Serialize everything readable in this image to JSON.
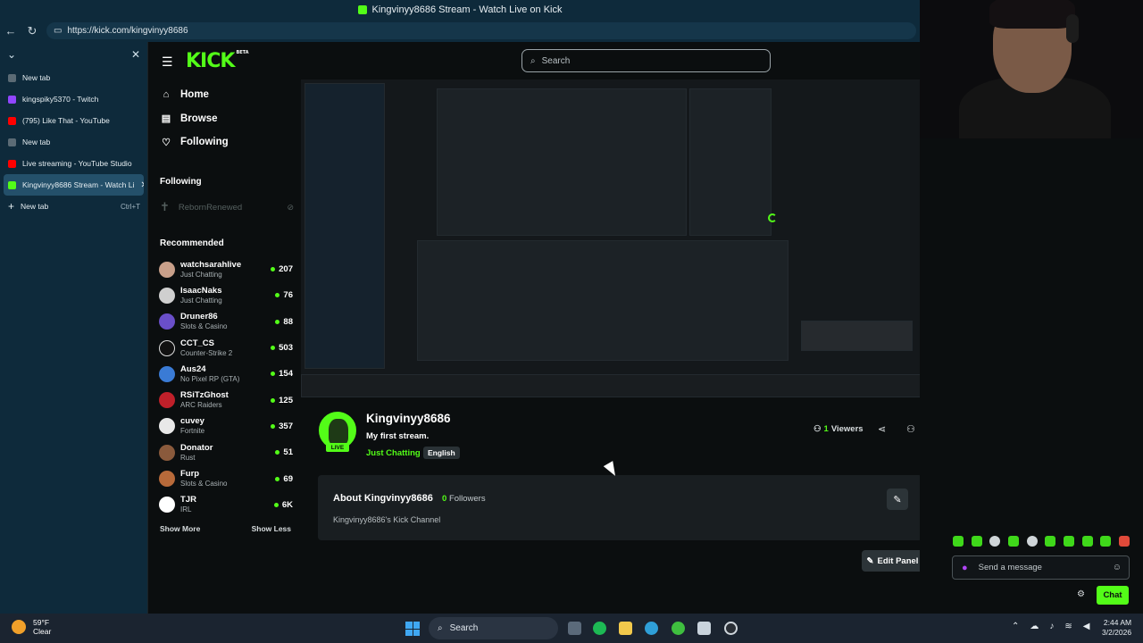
{
  "browser": {
    "window_title": "Kingvinyy8686 Stream - Watch Live on Kick",
    "url": "https://kick.com/kingvinyy8686",
    "tabs": [
      {
        "label": "New tab",
        "favicon_color": "#5b6b75"
      },
      {
        "label": "kingspiky5370 - Twitch",
        "favicon_color": "#9146ff"
      },
      {
        "label": "(795) Like That - YouTube",
        "favicon_color": "#ff0000"
      },
      {
        "label": "New tab",
        "favicon_color": "#5b6b75"
      },
      {
        "label": "Live streaming - YouTube Studio",
        "favicon_color": "#ff0000"
      },
      {
        "label": "Kingvinyy8686 Stream - Watch Li",
        "favicon_color": "#53fc18"
      }
    ],
    "new_tab_label": "New tab",
    "new_tab_shortcut": "Ctrl+T"
  },
  "kick": {
    "logo": "KICK",
    "logo_badge": "BETA",
    "search_placeholder": "Search",
    "nav": [
      {
        "label": "Home",
        "icon": "home-icon"
      },
      {
        "label": "Browse",
        "icon": "browse-icon"
      },
      {
        "label": "Following",
        "icon": "heart-icon"
      }
    ],
    "following_title": "Following",
    "following": [
      {
        "name": "RebornRenewed"
      }
    ],
    "recommended_title": "Recommended",
    "recommended": [
      {
        "name": "watchsarahlive",
        "category": "Just Chatting",
        "viewers": "207",
        "color": "#c9a08a"
      },
      {
        "name": "IsaacNaks",
        "category": "Just Chatting",
        "viewers": "76",
        "color": "#cfcfcf"
      },
      {
        "name": "Druner86",
        "category": "Slots & Casino",
        "viewers": "88",
        "color": "#6a4fc9"
      },
      {
        "name": "CCT_CS",
        "category": "Counter-Strike 2",
        "viewers": "503",
        "color": "#111111"
      },
      {
        "name": "Aus24",
        "category": "No Pixel RP (GTA)",
        "viewers": "154",
        "color": "#3a7bd5"
      },
      {
        "name": "RSiTzGhost",
        "category": "ARC Raiders",
        "viewers": "125",
        "color": "#c0202a"
      },
      {
        "name": "cuvey",
        "category": "Fortnite",
        "viewers": "357",
        "color": "#e8e8e8"
      },
      {
        "name": "Donator",
        "category": "Rust",
        "viewers": "51",
        "color": "#8a5a3c"
      },
      {
        "name": "Furp",
        "category": "Slots & Casino",
        "viewers": "69",
        "color": "#b86a3a"
      },
      {
        "name": "TJR",
        "category": "IRL",
        "viewers": "6K",
        "color": "#ffffff"
      }
    ],
    "show_more": "Show More",
    "show_less": "Show Less",
    "stream": {
      "streamer": "Kingvinyy8686",
      "title": "My first stream.",
      "category": "Just Chatting",
      "language": "English",
      "live_badge": "LIVE",
      "viewers_count": "1",
      "viewers_label": "Viewers"
    },
    "about": {
      "title": "About Kingvinyy8686",
      "followers_count": "0",
      "followers_label": "Followers",
      "description": "Kingvinyy8686's Kick Channel"
    },
    "edit_panel": "Edit Panel",
    "chat": {
      "placeholder": "Send a message",
      "button": "Chat"
    },
    "accent": "#53fc18"
  },
  "taskbar": {
    "temperature": "59°F",
    "weather": "Clear",
    "search": "Search",
    "time": "2:44 AM",
    "date": "3/2/2026"
  }
}
